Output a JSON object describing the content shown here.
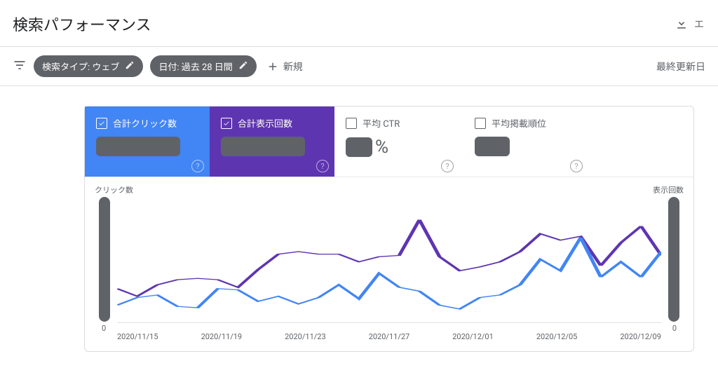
{
  "header": {
    "title": "検索パフォーマンス",
    "export_label": "エ"
  },
  "toolbar": {
    "filter_search_type": "検索タイプ: ウェブ",
    "filter_date": "日付: 過去 28 日間",
    "new_label": "新規",
    "last_update_label": "最終更新日"
  },
  "metrics": {
    "clicks": {
      "label": "合計クリック数",
      "checked": true,
      "value_redacted": true
    },
    "impressions": {
      "label": "合計表示回数",
      "checked": true,
      "value_redacted": true
    },
    "ctr": {
      "label": "平均 CTR",
      "checked": false,
      "value_redacted": true,
      "suffix": "%"
    },
    "position": {
      "label": "平均掲載順位",
      "checked": false,
      "value_redacted": true
    }
  },
  "chart": {
    "left_axis_title": "クリック数",
    "right_axis_title": "表示回数",
    "left_zero": "0",
    "right_zero": "0",
    "xticks": [
      "2020/11/15",
      "2020/11/19",
      "2020/11/23",
      "2020/11/27",
      "2020/12/01",
      "2020/12/05",
      "2020/12/09"
    ]
  },
  "colors": {
    "clicks": "#4285f4",
    "impressions": "#5e35b1"
  },
  "chart_data": {
    "type": "line",
    "title": "検索パフォーマンス",
    "x": [
      "2020/11/15",
      "2020/11/16",
      "2020/11/17",
      "2020/11/18",
      "2020/11/19",
      "2020/11/20",
      "2020/11/21",
      "2020/11/22",
      "2020/11/23",
      "2020/11/24",
      "2020/11/25",
      "2020/11/26",
      "2020/11/27",
      "2020/11/28",
      "2020/11/29",
      "2020/11/30",
      "2020/12/01",
      "2020/12/02",
      "2020/12/03",
      "2020/12/04",
      "2020/12/05",
      "2020/12/06",
      "2020/12/07",
      "2020/12/08",
      "2020/12/09",
      "2020/12/10",
      "2020/12/11",
      "2020/12/12"
    ],
    "series_note": "Axis tick values are redacted in the source image; values below are relative (0-100) read from pixel heights, not absolute counts.",
    "series": [
      {
        "name": "クリック数",
        "color": "#4285f4",
        "values": [
          14,
          20,
          22,
          13,
          12,
          27,
          26,
          17,
          21,
          15,
          20,
          30,
          19,
          39,
          28,
          25,
          14,
          11,
          20,
          22,
          30,
          50,
          41,
          67,
          36,
          48,
          36,
          56
        ]
      },
      {
        "name": "表示回数",
        "color": "#5e35b1",
        "values": [
          27,
          21,
          30,
          34,
          35,
          34,
          28,
          42,
          54,
          56,
          54,
          54,
          48,
          52,
          53,
          81,
          52,
          41,
          44,
          48,
          56,
          70,
          65,
          68,
          45,
          63,
          76,
          53
        ]
      }
    ],
    "ylim": [
      0,
      100
    ],
    "xlabel": "",
    "ylabel_left": "クリック数",
    "ylabel_right": "表示回数"
  }
}
